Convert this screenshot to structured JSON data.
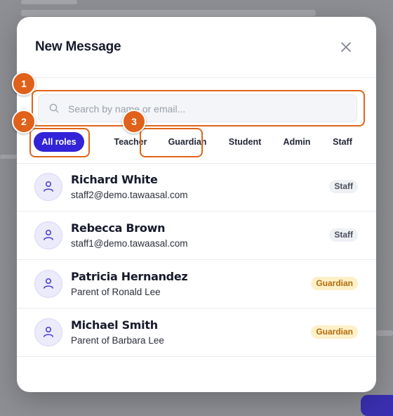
{
  "modal": {
    "title": "New Message"
  },
  "search": {
    "placeholder": "Search by name or email...",
    "value": ""
  },
  "filters": [
    {
      "label": "All roles",
      "active": true
    },
    {
      "label": "Teacher",
      "active": false
    },
    {
      "label": "Guardian",
      "active": false
    },
    {
      "label": "Student",
      "active": false
    },
    {
      "label": "Admin",
      "active": false
    },
    {
      "label": "Staff",
      "active": false
    }
  ],
  "contacts": [
    {
      "name": "Richard White",
      "detail": "staff2@demo.tawaasal.com",
      "role": "Staff"
    },
    {
      "name": "Rebecca Brown",
      "detail": "staff1@demo.tawaasal.com",
      "role": "Staff"
    },
    {
      "name": "Patricia Hernandez",
      "detail": "Parent of Ronald Lee",
      "role": "Guardian"
    },
    {
      "name": "Michael Smith",
      "detail": "Parent of Barbara Lee",
      "role": "Guardian"
    }
  ],
  "annotations": [
    "1",
    "2",
    "3"
  ],
  "colors": {
    "accent": "#3323d8",
    "annotation": "#e0611a",
    "guardian_badge_bg": "#fdf0c9",
    "guardian_badge_text": "#b46a0a",
    "staff_badge_bg": "#eef0f4"
  },
  "icons": {
    "close": "close-icon",
    "search": "search-icon",
    "avatar": "user-icon"
  }
}
